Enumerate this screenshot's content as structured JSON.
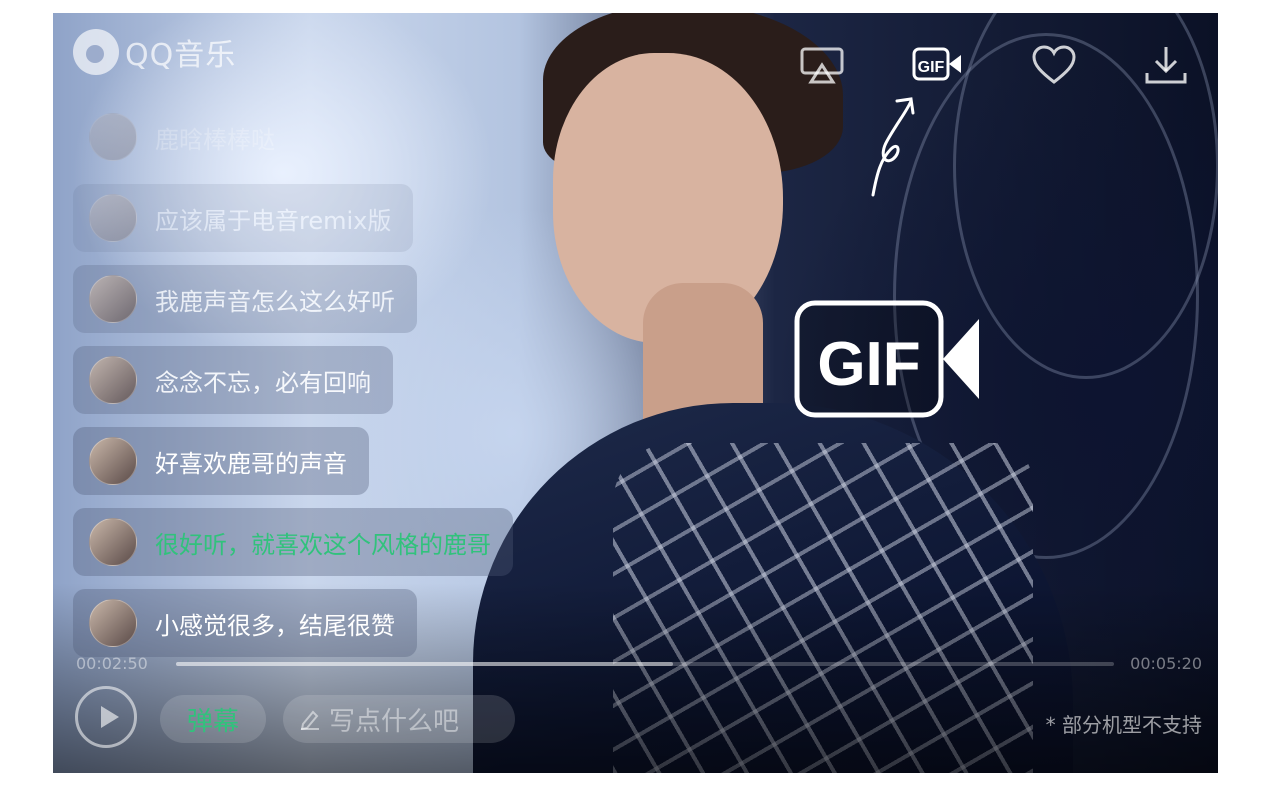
{
  "app": {
    "logo_text": "QQ音乐"
  },
  "toolbar": {
    "airplay_icon": "airplay-icon",
    "gif_icon": "gif-camera-icon",
    "favorite_icon": "heart-icon",
    "download_icon": "download-icon"
  },
  "annotation": {
    "gif_callout": "GIF"
  },
  "comments": [
    {
      "text": "鹿晗棒棒哒",
      "highlight": false
    },
    {
      "text": "应该属于电音remix版",
      "highlight": false
    },
    {
      "text": "我鹿声音怎么这么好听",
      "highlight": false
    },
    {
      "text": "念念不忘，必有回响",
      "highlight": false
    },
    {
      "text": "好喜欢鹿哥的声音",
      "highlight": false
    },
    {
      "text": "很好听，就喜欢这个风格的鹿哥",
      "highlight": true
    },
    {
      "text": "小感觉很多，结尾很赞",
      "highlight": false
    }
  ],
  "progress": {
    "current_time": "00:02:50",
    "total_time": "00:05:20",
    "fraction": 0.53
  },
  "controls": {
    "danmu_label": "弹幕",
    "write_placeholder": "写点什么吧",
    "note": "* 部分机型不支持"
  },
  "colors": {
    "accent": "#31c27c"
  }
}
